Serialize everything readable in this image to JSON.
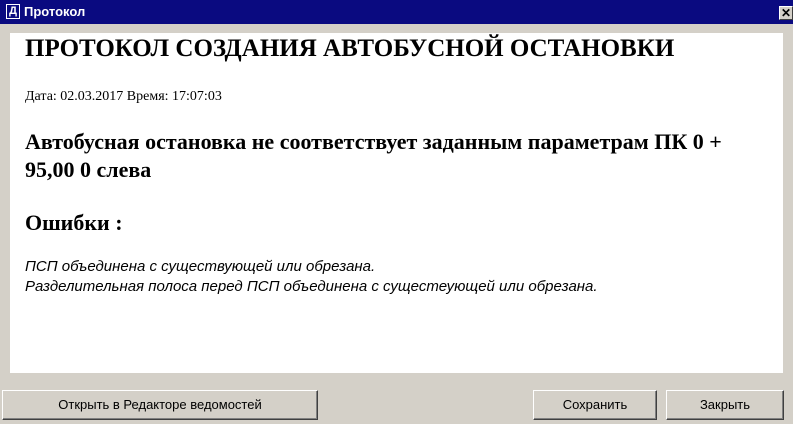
{
  "window": {
    "icon_glyph": "Д",
    "title": "Протокол",
    "close_glyph": "✕"
  },
  "report": {
    "heading": "ПРОТОКОЛ СОЗДАНИЯ АВТОБУСНОЙ ОСТАНОВКИ",
    "datetime": "Дата: 02.03.2017 Время: 17:07:03",
    "status": "Автобусная остановка не соответствует заданным параметрам ПК 0 + 95,00 0 слева",
    "errors_heading": "Ошибки :",
    "errors": [
      "ПСП объединена с существующей или обрезана.",
      "Разделительная полоса перед ПСП объединена с сущестеующей или обрезана."
    ]
  },
  "buttons": {
    "open_editor": "Открыть в Редакторе ведомостей",
    "save": "Сохранить",
    "close": "Закрыть"
  }
}
